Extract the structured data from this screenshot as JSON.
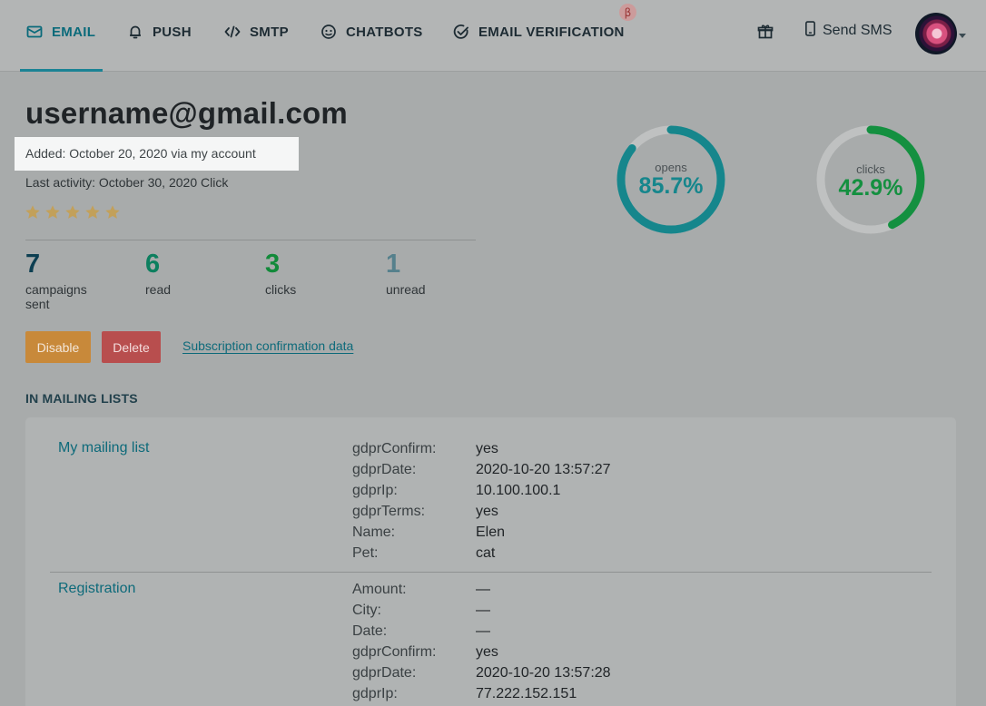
{
  "nav": {
    "items": [
      {
        "label": "EMAIL",
        "icon": "mail-icon"
      },
      {
        "label": "PUSH",
        "icon": "bell-icon"
      },
      {
        "label": "SMTP",
        "icon": "code-icon"
      },
      {
        "label": "CHATBOTS",
        "icon": "chatbot-icon"
      },
      {
        "label": "EMAIL VERIFICATION",
        "icon": "check-circle-icon"
      }
    ],
    "beta_badge": "β",
    "send_sms": "Send SMS",
    "active_index": 0
  },
  "subscriber": {
    "email": "username@gmail.com",
    "added": "Added: October 20, 2020 via my account",
    "last_activity": "Last activity: October 30, 2020 Click",
    "rating": 5
  },
  "stats": [
    {
      "value": "7",
      "label": "campaigns sent",
      "color": "#0d3f52"
    },
    {
      "value": "6",
      "label": "read",
      "color": "#0d7f5f"
    },
    {
      "value": "3",
      "label": "clicks",
      "color": "#128a3a"
    },
    {
      "value": "1",
      "label": "unread",
      "color": "#55808c"
    }
  ],
  "actions": {
    "disable": "Disable",
    "delete": "Delete",
    "subscription_link": "Subscription confirmation data"
  },
  "gauges": {
    "opens": {
      "label": "opens",
      "value_text": "85.7%",
      "fraction": 0.857,
      "color": "#16868c"
    },
    "clicks": {
      "label": "clicks",
      "value_text": "42.9%",
      "fraction": 0.429,
      "color": "#149040"
    }
  },
  "mailing": {
    "title": "IN MAILING LISTS",
    "lists": [
      {
        "name": "My mailing list",
        "fields": [
          {
            "key": "gdprConfirm:",
            "value": "yes"
          },
          {
            "key": "gdprDate:",
            "value": "2020-10-20 13:57:27"
          },
          {
            "key": "gdprIp:",
            "value": "10.100.100.1"
          },
          {
            "key": "gdprTerms:",
            "value": "yes"
          },
          {
            "key": "Name:",
            "value": "Elen"
          },
          {
            "key": "Pet:",
            "value": "cat"
          }
        ]
      },
      {
        "name": "Registration",
        "fields": [
          {
            "key": "Amount:",
            "value": "—"
          },
          {
            "key": "City:",
            "value": "—"
          },
          {
            "key": "Date:",
            "value": "—"
          },
          {
            "key": "gdprConfirm:",
            "value": "yes"
          },
          {
            "key": "gdprDate:",
            "value": "2020-10-20 13:57:28"
          },
          {
            "key": "gdprIp:",
            "value": "77.222.152.151"
          }
        ]
      }
    ]
  }
}
